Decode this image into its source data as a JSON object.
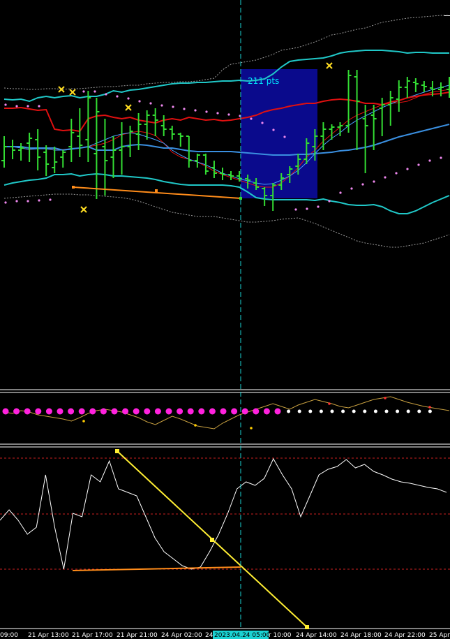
{
  "chart_data": {
    "type": "line",
    "x_labels": [
      "09:00",
      "21 Apr 13:00",
      "21 Apr 17:00",
      "21 Apr 21:00",
      "24 Apr 02:00",
      "24",
      "2023.04.24 05:00",
      "r 10:00",
      "24 Apr 14:00",
      "24 Apr 18:00",
      "24 Apr 22:00",
      "25 Apr"
    ],
    "crosshair_label": "2023.04.24 05:00",
    "annotation": "211 pts",
    "colors": {
      "background": "#000000",
      "bars": "#33dd33",
      "bollinger_outer": "#20c8c8",
      "bollinger_mid": "#e01010",
      "moving_avg": "#3a8fe0",
      "support": "#ff8c1a",
      "trendline": "#ffee33",
      "box": "#0a0a8c",
      "crosshair": "#1ad3d3",
      "dots_bull": "#ff22dd",
      "dots_bear": "#ffffff",
      "oscillator": "#ffffff"
    },
    "main_panel": {
      "bars": [
        [
          230,
          195,
          240,
          210
        ],
        [
          210,
          200,
          228,
          215
        ],
        [
          215,
          205,
          230,
          212
        ],
        [
          205,
          190,
          232,
          198
        ],
        [
          200,
          185,
          244,
          225
        ],
        [
          218,
          208,
          252,
          235
        ],
        [
          240,
          210,
          248,
          232
        ],
        [
          225,
          215,
          240,
          218
        ],
        [
          210,
          170,
          232,
          190
        ],
        [
          195,
          155,
          225,
          208
        ],
        [
          200,
          130,
          232,
          140
        ],
        [
          220,
          140,
          285,
          160
        ],
        [
          210,
          170,
          280,
          230
        ],
        [
          225,
          195,
          255,
          215
        ],
        [
          215,
          175,
          250,
          210
        ],
        [
          210,
          180,
          225,
          188
        ],
        [
          192,
          162,
          215,
          178
        ],
        [
          178,
          158,
          200,
          165
        ],
        [
          165,
          155,
          195,
          172
        ],
        [
          180,
          165,
          195,
          185
        ],
        [
          185,
          180,
          200,
          192
        ],
        [
          192,
          190,
          210,
          195
        ],
        [
          195,
          195,
          240,
          230
        ],
        [
          230,
          220,
          240,
          222
        ],
        [
          222,
          220,
          250,
          245
        ],
        [
          240,
          230,
          255,
          248
        ],
        [
          248,
          240,
          258,
          250
        ],
        [
          250,
          245,
          258,
          252
        ],
        [
          252,
          245,
          260,
          256
        ],
        [
          256,
          250,
          270,
          258
        ],
        [
          262,
          255,
          272,
          268
        ],
        [
          270,
          268,
          295,
          280
        ],
        [
          280,
          262,
          302,
          265
        ],
        [
          265,
          248,
          272,
          255
        ],
        [
          250,
          238,
          262,
          242
        ],
        [
          238,
          220,
          250,
          228
        ],
        [
          228,
          198,
          235,
          205
        ],
        [
          210,
          185,
          230,
          195
        ],
        [
          195,
          175,
          215,
          185
        ],
        [
          185,
          178,
          200,
          182
        ],
        [
          182,
          175,
          195,
          180
        ],
        [
          180,
          100,
          190,
          108
        ],
        [
          110,
          100,
          215,
          145
        ],
        [
          170,
          150,
          248,
          180
        ],
        [
          165,
          150,
          215,
          170
        ],
        [
          155,
          140,
          195,
          150
        ],
        [
          150,
          130,
          180,
          140
        ],
        [
          142,
          115,
          160,
          125
        ],
        [
          125,
          110,
          140,
          116
        ],
        [
          118,
          112,
          132,
          120
        ],
        [
          122,
          116,
          132,
          124
        ],
        [
          126,
          116,
          138,
          128
        ],
        [
          128,
          118,
          138,
          125
        ],
        [
          128,
          110,
          140,
          130
        ]
      ],
      "upper_band": [
        142,
        143,
        142,
        145,
        140,
        138,
        140,
        138,
        137,
        140,
        138,
        138,
        135,
        130,
        132,
        129,
        128,
        126,
        124,
        122,
        120,
        119,
        119,
        118,
        118,
        117,
        116,
        116,
        115,
        116,
        115,
        113,
        106,
        96,
        88,
        86,
        85,
        84,
        83,
        80,
        76,
        74,
        73,
        72,
        72,
        72,
        73,
        74,
        76,
        75,
        75,
        76,
        76,
        76
      ],
      "mid_band": [
        155,
        155,
        154,
        156,
        158,
        157,
        185,
        187,
        186,
        188,
        170,
        166,
        165,
        168,
        170,
        168,
        172,
        174,
        176,
        172,
        170,
        172,
        168,
        170,
        172,
        171,
        173,
        172,
        170,
        168,
        165,
        160,
        157,
        155,
        152,
        150,
        148,
        148,
        145,
        143,
        142,
        143,
        145,
        148,
        148,
        150,
        146,
        144,
        140,
        138,
        136,
        135,
        134,
        132
      ],
      "lower_band": [
        265,
        262,
        260,
        258,
        257,
        255,
        250,
        250,
        249,
        252,
        250,
        249,
        250,
        252,
        252,
        253,
        254,
        255,
        257,
        260,
        262,
        264,
        265,
        265,
        265,
        265,
        265,
        266,
        268,
        275,
        283,
        285,
        286,
        286,
        286,
        286,
        286,
        287,
        285,
        288,
        290,
        293,
        294,
        294,
        293,
        296,
        302,
        306,
        306,
        302,
        296,
        290,
        285,
        280
      ],
      "ma": [
        210,
        210,
        210,
        212,
        212,
        212,
        212,
        215,
        213,
        212,
        210,
        215,
        215,
        215,
        210,
        208,
        207,
        208,
        210,
        212,
        212,
        214,
        216,
        217,
        217,
        217,
        217,
        217,
        218,
        219,
        220,
        221,
        222,
        222,
        222,
        221,
        221,
        220,
        219,
        218,
        216,
        215,
        213,
        211,
        208,
        204,
        200,
        196,
        193,
        190,
        187,
        184,
        181,
        178
      ],
      "thin_red": [
        210,
        210,
        212,
        214,
        212,
        212,
        215,
        214,
        213,
        212,
        210,
        208,
        205,
        200,
        193,
        190,
        188,
        190,
        194,
        205,
        218,
        225,
        228,
        232,
        238,
        245,
        250,
        254,
        258,
        262,
        266,
        268,
        268,
        262,
        252,
        240,
        225,
        215,
        202,
        192,
        182,
        172,
        165,
        160,
        155,
        150,
        148,
        147,
        145,
        140,
        135,
        132,
        130,
        128
      ],
      "thin_blue": [
        210,
        210,
        212,
        214,
        213,
        213,
        215,
        215,
        214,
        212,
        210,
        205,
        200,
        195,
        192,
        190,
        192,
        196,
        200,
        205,
        215,
        222,
        228,
        232,
        236,
        242,
        248,
        252,
        256,
        259,
        262,
        264,
        263,
        258,
        252,
        244,
        233,
        220,
        208,
        198,
        190,
        180,
        172,
        166,
        160,
        154,
        149,
        144,
        140,
        136,
        132,
        128,
        125,
        122
      ],
      "upper_envelope": [
        126,
        127,
        127,
        128,
        128,
        127,
        127,
        128,
        127,
        127,
        126,
        125,
        124,
        124,
        123,
        122,
        122,
        120,
        119,
        118,
        118,
        117,
        117,
        116,
        114,
        112,
        100,
        92,
        90,
        88,
        86,
        82,
        78,
        72,
        70,
        68,
        64,
        60,
        55,
        50,
        48,
        45,
        42,
        40,
        36,
        32,
        30,
        28,
        26,
        25,
        24,
        23,
        22,
        22
      ],
      "lower_envelope": [
        284,
        283,
        282,
        281,
        280,
        279,
        278,
        278,
        278,
        279,
        279,
        280,
        281,
        282,
        283,
        285,
        288,
        292,
        296,
        300,
        304,
        306,
        308,
        310,
        310,
        310,
        312,
        314,
        316,
        318,
        318,
        317,
        316,
        314,
        313,
        312,
        316,
        320,
        325,
        330,
        335,
        340,
        345,
        348,
        350,
        352,
        354,
        354,
        352,
        350,
        348,
        344,
        340,
        336
      ],
      "support_points": [
        [
          105,
          268
        ],
        [
          345,
          284
        ]
      ],
      "crosses": [
        [
          88,
          128
        ],
        [
          104,
          132
        ],
        [
          120,
          300
        ],
        [
          184,
          154
        ],
        [
          472,
          94
        ]
      ],
      "stop_dots_upper": [
        [
          120,
          131
        ],
        [
          136,
          131
        ],
        [
          152,
          135
        ],
        [
          168,
          138
        ],
        [
          184,
          141
        ],
        [
          200,
          145
        ],
        [
          216,
          148
        ],
        [
          232,
          151
        ],
        [
          248,
          153
        ],
        [
          264,
          156
        ],
        [
          280,
          158
        ],
        [
          296,
          160
        ],
        [
          312,
          162
        ],
        [
          328,
          164
        ],
        [
          344,
          166
        ],
        [
          360,
          170
        ],
        [
          376,
          176
        ],
        [
          392,
          186
        ],
        [
          408,
          196
        ],
        [
          8,
          150
        ],
        [
          24,
          152
        ],
        [
          40,
          152
        ],
        [
          56,
          152
        ]
      ],
      "stop_dots_lower": [
        [
          8,
          290
        ],
        [
          24,
          288
        ],
        [
          40,
          288
        ],
        [
          56,
          287
        ],
        [
          72,
          286
        ],
        [
          424,
          300
        ],
        [
          440,
          299
        ],
        [
          456,
          296
        ],
        [
          472,
          288
        ],
        [
          488,
          276
        ],
        [
          504,
          270
        ],
        [
          520,
          264
        ],
        [
          536,
          260
        ],
        [
          552,
          254
        ],
        [
          568,
          248
        ],
        [
          584,
          242
        ],
        [
          600,
          236
        ],
        [
          616,
          230
        ],
        [
          632,
          226
        ]
      ]
    },
    "dots_panel": {
      "bull_count": 26,
      "bear_count": 14,
      "line": [
        590,
        592,
        588,
        590,
        594,
        596,
        598,
        600,
        603,
        598,
        592,
        588,
        586,
        588,
        590,
        594,
        598,
        604,
        608,
        602,
        596,
        600,
        605,
        610,
        612,
        614,
        606,
        600,
        594,
        590,
        586,
        582,
        578,
        582,
        586,
        580,
        576,
        572,
        575,
        578,
        582,
        584,
        580,
        576,
        572,
        570,
        568,
        572,
        576,
        579,
        582,
        584,
        586,
        588
      ]
    },
    "oscillator_panel": {
      "levels": [
        656,
        736,
        815
      ],
      "line": [
        745,
        730,
        745,
        765,
        755,
        680,
        755,
        815,
        735,
        740,
        680,
        690,
        660,
        700,
        705,
        710,
        740,
        770,
        790,
        800,
        810,
        815,
        812,
        790,
        765,
        735,
        700,
        690,
        695,
        685,
        657,
        680,
        700,
        740,
        710,
        680,
        672,
        668,
        658,
        670,
        665,
        675,
        680,
        686,
        690,
        692,
        695,
        698,
        700,
        705
      ]
    }
  }
}
